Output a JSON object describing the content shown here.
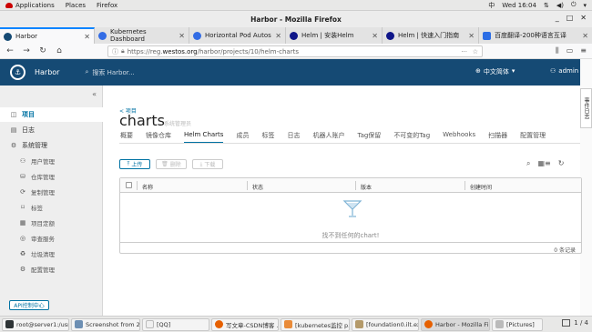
{
  "gnome": {
    "applications": "Applications",
    "places": "Places",
    "firefox": "Firefox",
    "input_method": "中",
    "time": "Wed 16:04"
  },
  "window": {
    "title": "Harbor - Mozilla Firefox"
  },
  "tabs": [
    {
      "label": "Harbor",
      "color": "#154a74"
    },
    {
      "label": "Kubernetes Dashboard",
      "color": "#326ce5"
    },
    {
      "label": "Horizontal Pod Autoscale",
      "color": "#326ce5"
    },
    {
      "label": "Helm | 安装Helm",
      "color": "#0f1689"
    },
    {
      "label": "Helm | 快速入门指南",
      "color": "#0f1689"
    },
    {
      "label": "百度翻译-200种语言互译",
      "color": "#2b6de5"
    }
  ],
  "nav": {
    "url_prefix": "https://reg.",
    "url_host": "westos.org",
    "url_path": "/harbor/projects/10/helm-charts"
  },
  "header": {
    "app_name": "Harbor",
    "search_placeholder": "搜索 Harbor...",
    "language": "中文简体",
    "user": "admin"
  },
  "side_tab": "事件日志",
  "sidebar": {
    "items": [
      {
        "label": "项目",
        "icon": "project-icon"
      },
      {
        "label": "日志",
        "icon": "log-icon"
      },
      {
        "label": "系统管理",
        "icon": "admin-icon"
      },
      {
        "label": "用户管理",
        "icon": "user-icon"
      },
      {
        "label": "仓库管理",
        "icon": "registry-icon"
      },
      {
        "label": "复制管理",
        "icon": "replication-icon"
      },
      {
        "label": "标签",
        "icon": "tag-icon"
      },
      {
        "label": "项目定额",
        "icon": "quota-icon"
      },
      {
        "label": "审查服务",
        "icon": "scanner-icon"
      },
      {
        "label": "垃圾清理",
        "icon": "gc-icon"
      },
      {
        "label": "配置管理",
        "icon": "gear-icon"
      }
    ],
    "api_button": "API控制中心"
  },
  "main": {
    "breadcrumb": "< 项目",
    "title": "charts",
    "title_sub": "系统管理员",
    "tabs": [
      "概要",
      "镜像仓库",
      "Helm Charts",
      "成员",
      "标签",
      "日志",
      "机器人账户",
      "Tag保留",
      "不可变的Tag",
      "Webhooks",
      "扫描器",
      "配置管理"
    ],
    "active_tab": "Helm Charts",
    "upload_label": "上传",
    "delete_label": "删除",
    "download_label": "下载",
    "columns": [
      "名称",
      "状态",
      "版本",
      "创建时间"
    ],
    "empty_text": "找不到任何的chart!",
    "footer": "0 条记录"
  },
  "taskbar": {
    "items": [
      {
        "label": "root@server1:/usr...",
        "color": "#2e3436"
      },
      {
        "label": "Screenshot from 2...",
        "color": "#6d8fb3"
      },
      {
        "label": "[QQ]",
        "color": "#f0f0f0"
      },
      {
        "label": "写文章-CSDN博客 ...",
        "color": "#e66000"
      },
      {
        "label": "[kubernetes监控 p...",
        "color": "#e98b39"
      },
      {
        "label": "[foundation0.ilt.ex...",
        "color": "#b49a6a"
      },
      {
        "label": "Harbor - Mozilla Fi...",
        "color": "#e66000"
      },
      {
        "label": "[Pictures]",
        "color": "#bbbbbb"
      }
    ],
    "workspace": "1 / 4"
  }
}
